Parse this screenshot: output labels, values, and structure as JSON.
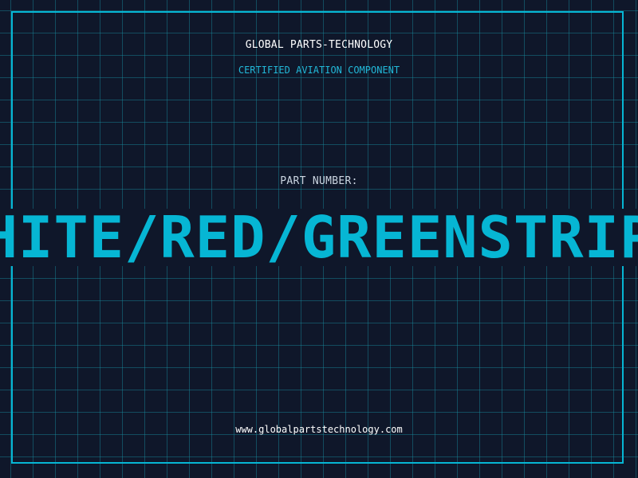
{
  "header": {
    "company_name": "GLOBAL PARTS-TECHNOLOGY",
    "subtitle": "CERTIFIED AVIATION COMPONENT"
  },
  "part": {
    "label": "PART NUMBER:",
    "value": "WHITE/RED/GREENSTRIPE"
  },
  "footer": {
    "url": "www.globalpartstechnology.com"
  },
  "colors": {
    "background": "#0f172a",
    "grid": "#188ca0",
    "accent": "#06b6d4",
    "text": "#ffffff"
  }
}
